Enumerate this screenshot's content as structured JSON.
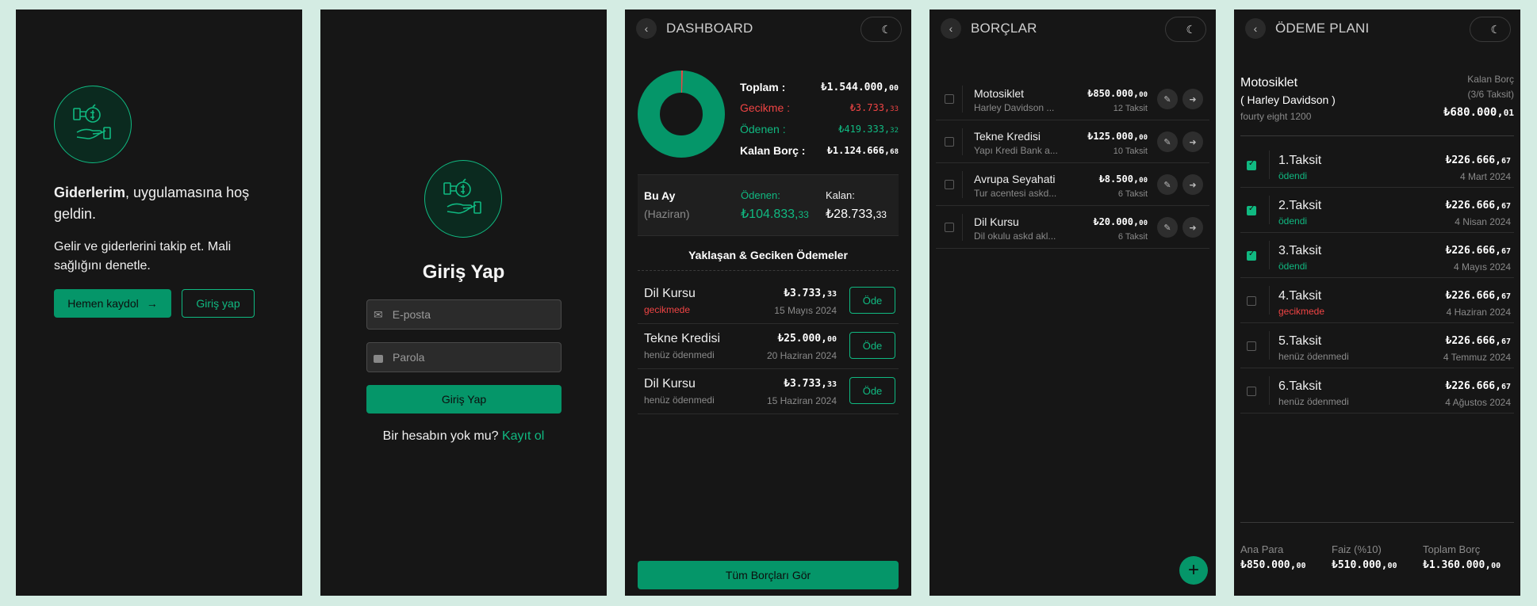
{
  "screen1": {
    "welcome_bold": "Giderlerim",
    "welcome_rest": ", uygulamasına hoş geldin.",
    "subtitle": "Gelir ve giderlerini takip et. Mali sağlığını denetle.",
    "signup_button": "Hemen kaydol",
    "signup_arrow": "→",
    "login_button": "Giriş yap"
  },
  "screen2": {
    "title": "Giriş Yap",
    "email_placeholder": "E-posta",
    "password_placeholder": "Parola",
    "submit_button": "Giriş Yap",
    "no_account_text": "Bir hesabın yok mu?",
    "register_link": "Kayıt ol"
  },
  "screen3": {
    "header_title": "DASHBOARD",
    "summary": {
      "total_label": "Toplam :",
      "total_int": "₺1.544.000,",
      "total_dec": "00",
      "late_label": "Gecikme :",
      "late_int": "₺3.733,",
      "late_dec": "33",
      "paid_label": "Ödenen :",
      "paid_int": "₺419.333,",
      "paid_dec": "32",
      "remaining_label": "Kalan Borç :",
      "remaining_int": "₺1.124.666,",
      "remaining_dec": "68"
    },
    "donut": {
      "paid_fraction": 0.2716,
      "late_fraction": 0.0024
    },
    "month": {
      "label": "Bu Ay",
      "month_name": "(Haziran)",
      "paid_label": "Ödenen:",
      "paid_int": "₺104.833,",
      "paid_dec": "33",
      "remaining_label": "Kalan:",
      "remaining_int": "₺28.733,",
      "remaining_dec": "33"
    },
    "upcoming_title": "Yaklaşan & Geciken Ödemeler",
    "upcoming": [
      {
        "name": "Dil Kursu",
        "status": "gecikmede",
        "amount_int": "₺3.733,",
        "amount_dec": "33",
        "date": "15 Mayıs 2024",
        "pay": "Öde"
      },
      {
        "name": "Tekne Kredisi",
        "status": "henüz ödenmedi",
        "amount_int": "₺25.000,",
        "amount_dec": "00",
        "date": "20 Haziran 2024",
        "pay": "Öde"
      },
      {
        "name": "Dil Kursu",
        "status": "henüz ödenmedi",
        "amount_int": "₺3.733,",
        "amount_dec": "33",
        "date": "15 Haziran 2024",
        "pay": "Öde"
      }
    ],
    "all_debts_button": "Tüm Borçları Gör"
  },
  "screen4": {
    "header_title": "BORÇLAR",
    "debts": [
      {
        "name": "Motosiklet",
        "sub": "Harley Davidson ...",
        "amount_int": "₺850.000,",
        "amount_dec": "00",
        "installments": "12 Taksit"
      },
      {
        "name": "Tekne Kredisi",
        "sub": "Yapı Kredi Bank a...",
        "amount_int": "₺125.000,",
        "amount_dec": "00",
        "installments": "10 Taksit"
      },
      {
        "name": "Avrupa Seyahati",
        "sub": "Tur acentesi askd...",
        "amount_int": "₺8.500,",
        "amount_dec": "00",
        "installments": "6 Taksit"
      },
      {
        "name": "Dil Kursu",
        "sub": "Dil okulu askd akl...",
        "amount_int": "₺20.000,",
        "amount_dec": "00",
        "installments": "6 Taksit"
      }
    ],
    "add_button": "+"
  },
  "screen5": {
    "header_title": "ÖDEME PLANI",
    "debt_name": "Motosiklet",
    "debt_sub": "( Harley Davidson )",
    "debt_detail": "fourty eight 1200",
    "remaining_label": "Kalan Borç",
    "remaining_count": "(3/6 Taksit)",
    "remaining_int": "₺680.000,",
    "remaining_dec": "01",
    "installments": [
      {
        "name": "1.Taksit",
        "status": "ödendi",
        "status_color": "#10b981",
        "checked": true,
        "amount_int": "₺226.666,",
        "amount_dec": "67",
        "date": "4 Mart 2024"
      },
      {
        "name": "2.Taksit",
        "status": "ödendi",
        "status_color": "#10b981",
        "checked": true,
        "amount_int": "₺226.666,",
        "amount_dec": "67",
        "date": "4 Nisan 2024"
      },
      {
        "name": "3.Taksit",
        "status": "ödendi",
        "status_color": "#10b981",
        "checked": true,
        "amount_int": "₺226.666,",
        "amount_dec": "67",
        "date": "4 Mayıs 2024"
      },
      {
        "name": "4.Taksit",
        "status": "gecikmede",
        "status_color": "#ef4444",
        "checked": false,
        "amount_int": "₺226.666,",
        "amount_dec": "67",
        "date": "4 Haziran 2024"
      },
      {
        "name": "5.Taksit",
        "status": "henüz ödenmedi",
        "status_color": "#8a8a8a",
        "checked": false,
        "amount_int": "₺226.666,",
        "amount_dec": "67",
        "date": "4 Temmuz 2024"
      },
      {
        "name": "6.Taksit",
        "status": "henüz ödenmedi",
        "status_color": "#8a8a8a",
        "checked": false,
        "amount_int": "₺226.666,",
        "amount_dec": "67",
        "date": "4 Ağustos 2024"
      }
    ],
    "footer": {
      "principal_label": "Ana Para",
      "principal_int": "₺850.000,",
      "principal_dec": "00",
      "interest_label": "Faiz (%10)",
      "interest_int": "₺510.000,",
      "interest_dec": "00",
      "total_label": "Toplam Borç",
      "total_int": "₺1.360.000,",
      "total_dec": "00"
    }
  },
  "colors": {
    "accent": "#10b981",
    "button": "#059669",
    "danger": "#ef4444",
    "panel": "#161616",
    "page": "#d4ece3"
  },
  "icons": [
    "money-hand-icon",
    "mail-icon",
    "lock-icon",
    "back-chevron-icon",
    "moon-icon",
    "edit-icon",
    "list-arrow-icon",
    "plus-icon"
  ]
}
